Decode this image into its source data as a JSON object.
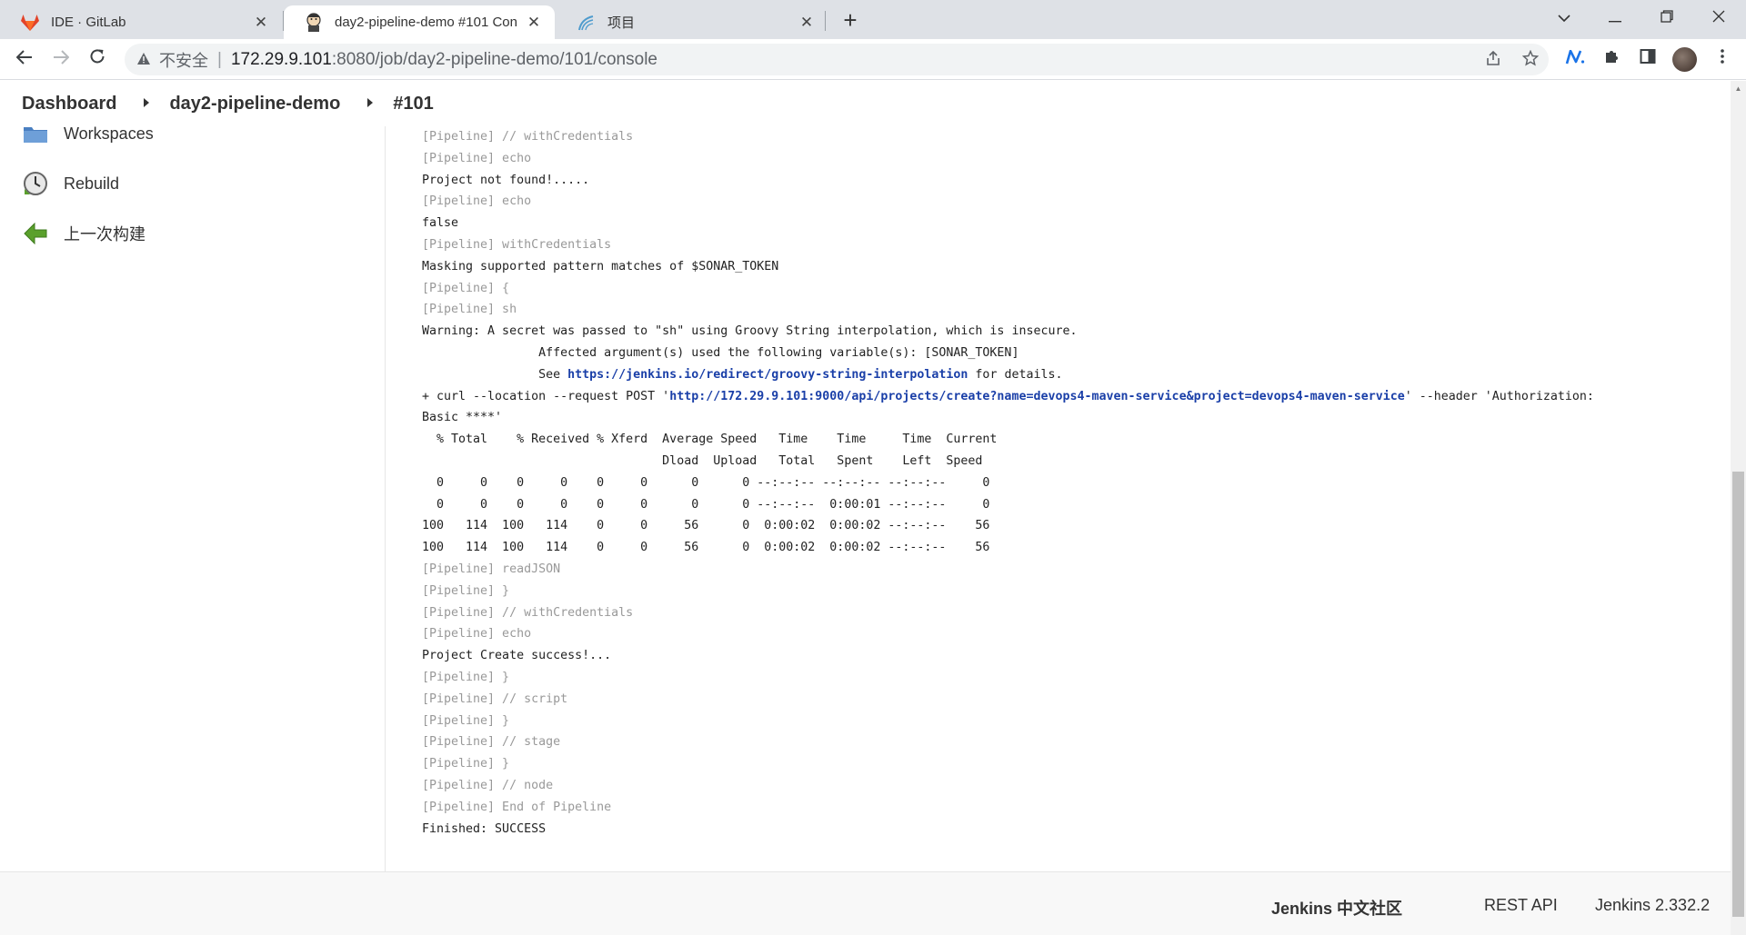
{
  "browser": {
    "tabs": [
      {
        "title": "IDE · GitLab",
        "icon": "gitlab-icon"
      },
      {
        "title": "day2-pipeline-demo #101 Con",
        "icon": "jenkins-icon"
      },
      {
        "title": "项目",
        "icon": "sonarqube-icon"
      }
    ],
    "close_glyph": "✕",
    "newtab_glyph": "+",
    "url": {
      "insecure_label": "不安全",
      "host": "172.29.9.101",
      "path": ":8080/job/day2-pipeline-demo/101/console"
    }
  },
  "breadcrumb": {
    "items": [
      "Dashboard",
      "day2-pipeline-demo",
      "#101"
    ]
  },
  "sidebar": {
    "items": [
      {
        "label": "Workspaces",
        "icon": "folder-icon"
      },
      {
        "label": "Rebuild",
        "icon": "rebuild-clock-icon"
      },
      {
        "label": "上一次构建",
        "icon": "arrow-left-icon"
      }
    ]
  },
  "console": {
    "lines": [
      {
        "kind": "pipeline",
        "text": "[Pipeline] // withCredentials"
      },
      {
        "kind": "pipeline",
        "text": "[Pipeline] echo"
      },
      {
        "kind": "output",
        "text": "Project not found!....."
      },
      {
        "kind": "pipeline",
        "text": "[Pipeline] echo"
      },
      {
        "kind": "output",
        "text": "false"
      },
      {
        "kind": "pipeline",
        "text": "[Pipeline] withCredentials"
      },
      {
        "kind": "output",
        "text": "Masking supported pattern matches of $SONAR_TOKEN"
      },
      {
        "kind": "pipeline",
        "text": "[Pipeline] {"
      },
      {
        "kind": "pipeline",
        "text": "[Pipeline] sh"
      },
      {
        "kind": "output",
        "text": "Warning: A secret was passed to \"sh\" using Groovy String interpolation, which is insecure."
      },
      {
        "kind": "output",
        "text": "\t\t Affected argument(s) used the following variable(s): [SONAR_TOKEN]"
      },
      {
        "kind": "link",
        "pre": "\t\t See ",
        "link": "https://jenkins.io/redirect/groovy-string-interpolation",
        "post": " for details."
      },
      {
        "kind": "link",
        "pre": "+ curl --location --request POST '",
        "link": "http://172.29.9.101:9000/api/projects/create?name=devops4-maven-service&project=devops4-maven-service",
        "post": "' --header 'Authorization:"
      },
      {
        "kind": "output",
        "text": "Basic ****'"
      },
      {
        "kind": "output",
        "text": "  % Total    % Received % Xferd  Average Speed   Time    Time     Time  Current"
      },
      {
        "kind": "output",
        "text": "                                 Dload  Upload   Total   Spent    Left  Speed"
      },
      {
        "kind": "output",
        "text": "  0     0    0     0    0     0      0      0 --:--:-- --:--:-- --:--:--     0"
      },
      {
        "kind": "output",
        "text": "  0     0    0     0    0     0      0      0 --:--:--  0:00:01 --:--:--     0"
      },
      {
        "kind": "output",
        "text": "100   114  100   114    0     0     56      0  0:00:02  0:00:02 --:--:--    56"
      },
      {
        "kind": "output",
        "text": "100   114  100   114    0     0     56      0  0:00:02  0:00:02 --:--:--    56"
      },
      {
        "kind": "pipeline",
        "text": "[Pipeline] readJSON"
      },
      {
        "kind": "pipeline",
        "text": "[Pipeline] }"
      },
      {
        "kind": "pipeline",
        "text": "[Pipeline] // withCredentials"
      },
      {
        "kind": "pipeline",
        "text": "[Pipeline] echo"
      },
      {
        "kind": "output",
        "text": "Project Create success!..."
      },
      {
        "kind": "pipeline",
        "text": "[Pipeline] }"
      },
      {
        "kind": "pipeline",
        "text": "[Pipeline] // script"
      },
      {
        "kind": "pipeline",
        "text": "[Pipeline] }"
      },
      {
        "kind": "pipeline",
        "text": "[Pipeline] // stage"
      },
      {
        "kind": "pipeline",
        "text": "[Pipeline] }"
      },
      {
        "kind": "pipeline",
        "text": "[Pipeline] // node"
      },
      {
        "kind": "pipeline",
        "text": "[Pipeline] End of Pipeline"
      },
      {
        "kind": "output",
        "text": "Finished: SUCCESS"
      }
    ]
  },
  "footer": {
    "community": "Jenkins 中文社区",
    "rest_api": "REST API",
    "version": "Jenkins 2.332.2"
  },
  "colors": {
    "link": "#1a3fa8",
    "pipeline_text": "#999999",
    "gitlab_orange": "#e24329",
    "rebuild_green": "#5aa02c"
  }
}
